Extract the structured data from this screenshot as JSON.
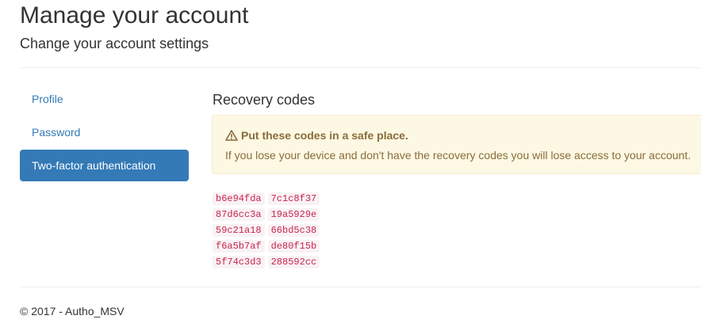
{
  "header": {
    "title": "Manage your account",
    "subtitle": "Change your account settings"
  },
  "nav": {
    "items": [
      {
        "label": "Profile",
        "active": false
      },
      {
        "label": "Password",
        "active": false
      },
      {
        "label": "Two-factor authentication",
        "active": true
      }
    ]
  },
  "main": {
    "section_title": "Recovery codes",
    "alert": {
      "icon": "warning-icon",
      "heading": "Put these codes in a safe place.",
      "body": "If you lose your device and don't have the recovery codes you will lose access to your account."
    },
    "codes": [
      "b6e94fda",
      "7c1c8f37",
      "87d6cc3a",
      "19a5929e",
      "59c21a18",
      "66bd5c38",
      "f6a5b7af",
      "de80f15b",
      "5f74c3d3",
      "288592cc"
    ]
  },
  "footer": {
    "text": "© 2017 - Autho_MSV"
  },
  "colors": {
    "link": "#337ab7",
    "active_bg": "#337ab7",
    "alert_bg": "#fcf8e3",
    "alert_text": "#8a6d3b",
    "code_text": "#c7254e",
    "code_bg": "#f9f2f4"
  }
}
